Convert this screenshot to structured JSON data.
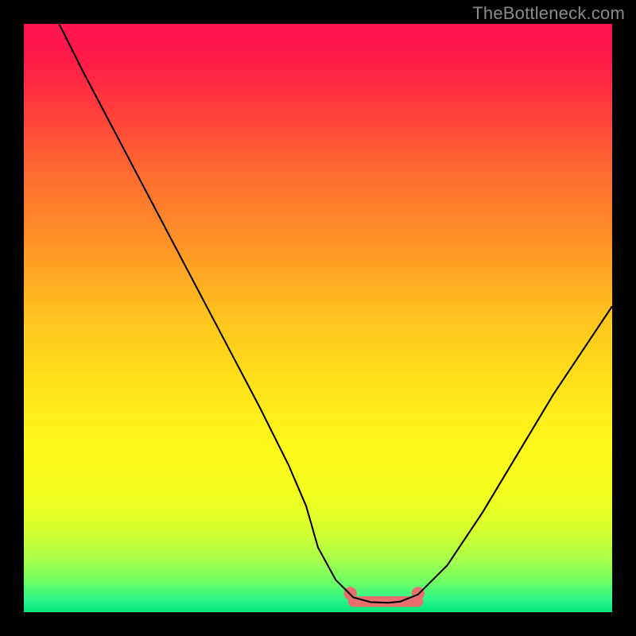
{
  "watermark": "TheBottleneck.com",
  "gradient": {
    "stops": [
      {
        "offset": 0.0,
        "color": "#ff1450"
      },
      {
        "offset": 0.06,
        "color": "#ff1a48"
      },
      {
        "offset": 0.14,
        "color": "#ff3b3b"
      },
      {
        "offset": 0.25,
        "color": "#ff6a30"
      },
      {
        "offset": 0.38,
        "color": "#ff9626"
      },
      {
        "offset": 0.5,
        "color": "#ffc41e"
      },
      {
        "offset": 0.62,
        "color": "#ffe41a"
      },
      {
        "offset": 0.72,
        "color": "#fff91a"
      },
      {
        "offset": 0.8,
        "color": "#f4ff1e"
      },
      {
        "offset": 0.86,
        "color": "#d6ff2e"
      },
      {
        "offset": 0.91,
        "color": "#a8ff4a"
      },
      {
        "offset": 0.95,
        "color": "#6cff66"
      },
      {
        "offset": 0.98,
        "color": "#28f58a"
      },
      {
        "offset": 1.0,
        "color": "#00e57a"
      }
    ]
  },
  "marker": {
    "color": "#e96f6f",
    "radius_frac": 0.011,
    "stroke_frac": 0.018
  },
  "chart_data": {
    "type": "line",
    "title": "",
    "xlabel": "",
    "ylabel": "",
    "xlim": [
      0,
      100
    ],
    "ylim": [
      0,
      100
    ],
    "series": [
      {
        "name": "main-curve",
        "x": [
          6,
          10,
          15,
          20,
          25,
          30,
          35,
          40,
          45,
          48,
          50,
          53,
          56,
          59,
          62,
          64,
          67,
          72,
          78,
          84,
          90,
          96,
          100
        ],
        "y": [
          100,
          92,
          82.5,
          73,
          63.5,
          54,
          44.5,
          35,
          25,
          18,
          11,
          5.5,
          2.5,
          1.7,
          1.6,
          1.8,
          3,
          8,
          17,
          27,
          37,
          46,
          52
        ]
      }
    ],
    "flat_segment": {
      "x_start": 56,
      "x_end": 67,
      "y": 1.8
    },
    "marker_endpoints": [
      {
        "x": 55.5,
        "y": 3.2
      },
      {
        "x": 67.0,
        "y": 3.2
      }
    ]
  }
}
